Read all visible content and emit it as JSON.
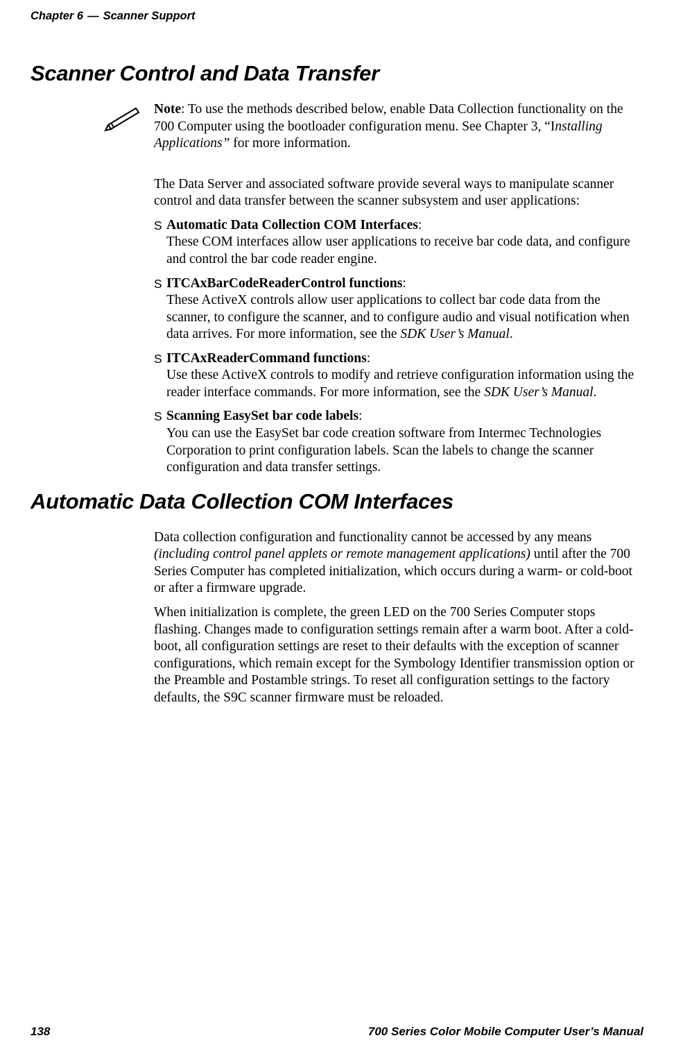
{
  "header": {
    "chapter": "Chapter 6",
    "dash": "—",
    "title": "Scanner Support"
  },
  "section1": {
    "heading": "Scanner Control and Data Transfer",
    "note_prefix": "Note",
    "note_body": ": To use the methods described below, enable Data Collection functionality on the 700 Computer using the bootloader configuration menu. See Chapter 3, “I",
    "note_italic": "nstalling Applications” ",
    "note_after": "for more information.",
    "intro": "The Data Server and associated software provide several ways to manipulate scanner control and data transfer between the scanner subsystem and user applications:",
    "items": [
      {
        "title": "Automatic Data Collection COM Interfaces",
        "body1": "These COM interfaces allow user applications to receive bar code data, and configure and control the bar code reader engine."
      },
      {
        "title": "ITCAxBarCodeReaderControl functions",
        "body1": "These ActiveX controls allow user applications to collect bar code data from the scanner, to configure the scanner, and to configure audio and visual notification when data arrives. For more information, see the ",
        "italic": "SDK User’s Manual",
        "body2": "."
      },
      {
        "title": "ITCAxReaderCommand functions",
        "body1": "Use these ActiveX controls to modify and retrieve configuration information using the reader interface commands. For more information, see the ",
        "italic": "SDK User’s Manual",
        "body2": "."
      },
      {
        "title": "Scanning EasySet bar code labels",
        "body1": "You can use the EasySet bar code creation software from Intermec Technologies Corporation to print configuration labels. Scan the labels to change the scanner configuration and data transfer settings."
      }
    ]
  },
  "section2": {
    "heading": "Automatic Data Collection COM Interfaces",
    "p1a": "Data collection configuration and functionality cannot be accessed by any means ",
    "p1i": "(including control panel applets or remote management applications)",
    "p1b": " until after the 700 Series Computer has completed initialization, which occurs during a warm- or cold-boot or after a firmware upgrade.",
    "p2": "When initialization is complete, the green LED on the 700 Series Computer stops flashing. Changes made to configuration settings remain after a warm boot. After a cold-boot, all configuration settings are reset to their defaults with the exception of scanner configurations, which remain except for the Symbology Identifier transmission option or the Preamble and Postamble strings. To reset all configuration settings to the factory defaults, the S9C scanner firmware must be reloaded."
  },
  "footer": {
    "page": "138",
    "title": "700 Series Color Mobile Computer User’s Manual"
  }
}
